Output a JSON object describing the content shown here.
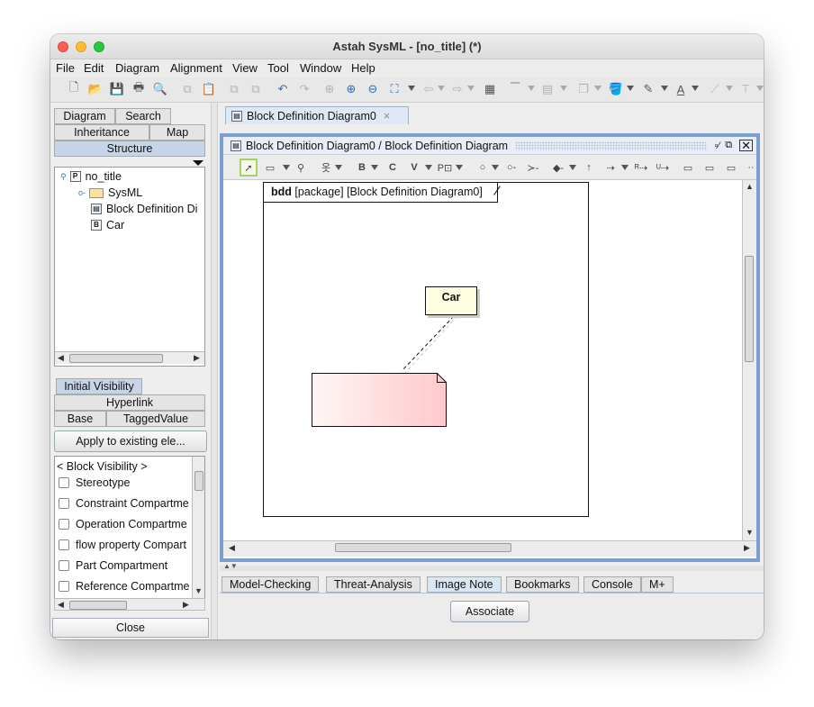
{
  "window": {
    "title": "Astah SysML - [no_title] (*)"
  },
  "menu": [
    "File",
    "Edit",
    "Diagram",
    "Alignment",
    "View",
    "Tool",
    "Window",
    "Help"
  ],
  "left_tabs": {
    "diagram": "Diagram",
    "search": "Search",
    "inheritance": "Inheritance",
    "map": "Map",
    "structure": "Structure"
  },
  "tree": [
    {
      "label": "no_title",
      "icon": "P"
    },
    {
      "label": "SysML",
      "icon": "folder"
    },
    {
      "label": "Block Definition Di",
      "icon": "diagram"
    },
    {
      "label": "Car",
      "icon": "B"
    }
  ],
  "prop_tabs": {
    "initial_visibility": "Initial Visibility",
    "hyperlink": "Hyperlink",
    "base": "Base",
    "tagged_value": "TaggedValue"
  },
  "apply_button": "Apply to existing ele...",
  "visibility": {
    "header": "< Block Visibility >",
    "items": [
      "Stereotype",
      "Constraint Compartme",
      "Operation Compartme",
      "flow property Compart",
      "Part Compartment",
      "Reference Compartme"
    ]
  },
  "close_button": "Close",
  "doc_tab": {
    "label": "Block Definition Diagram0",
    "close": "×"
  },
  "diagram": {
    "title": "Block Definition Diagram0 / Block Definition Diagram",
    "frame_kind": "bdd",
    "frame_label": "[package] [Block Definition Diagram0]",
    "block_name": "Car"
  },
  "bottom_tabs": [
    "Model-Checking",
    "Threat-Analysis",
    "Image Note",
    "Bookmarks",
    "Console",
    "M+"
  ],
  "selected_bottom_tab": "Image Note",
  "associate_button": "Associate",
  "colors": {
    "frame_border": "#7d9fd0",
    "block_fill": "#fffee0",
    "note_fill": "#ffd9db",
    "selected_tab": "#c6d6e8"
  }
}
